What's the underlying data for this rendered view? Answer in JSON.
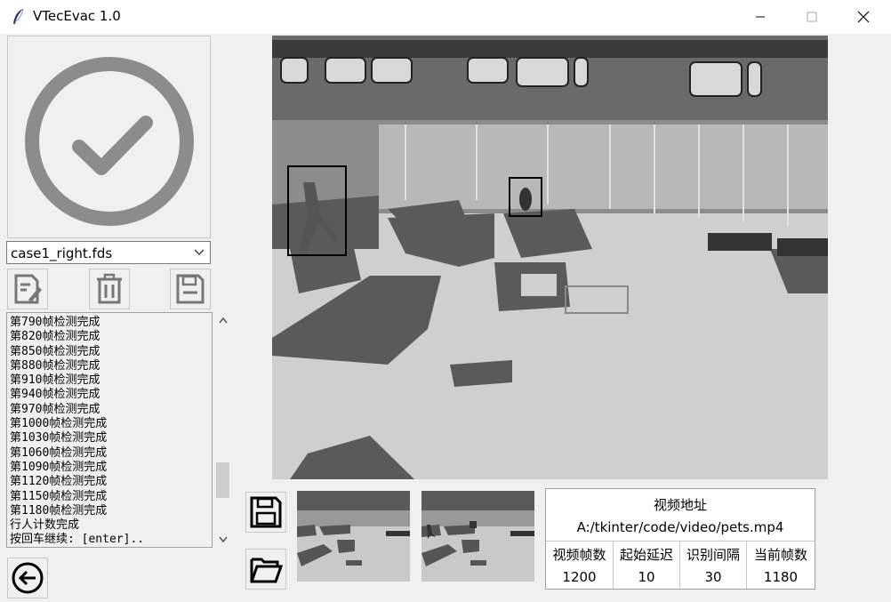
{
  "window": {
    "title": "VTecEvac 1.0"
  },
  "file_select": {
    "selected": "case1_right.fds"
  },
  "log": {
    "lines": [
      "第790帧检测完成",
      "第820帧检测完成",
      "第850帧检测完成",
      "第880帧检测完成",
      "第910帧检测完成",
      "第940帧检测完成",
      "第970帧检测完成",
      "第1000帧检测完成",
      "第1030帧检测完成",
      "第1060帧检测完成",
      "第1090帧检测完成",
      "第1120帧检测完成",
      "第1150帧检测完成",
      "第1180帧检测完成",
      "行人计数完成",
      "按回车继续: [enter].."
    ],
    "scroll_position": 0.8
  },
  "info": {
    "address_label": "视频地址",
    "address_value": "A:/tkinter/code/video/pets.mp4",
    "headers": [
      "视频帧数",
      "起始延迟",
      "识别间隔",
      "当前帧数"
    ],
    "values": [
      "1200",
      "10",
      "30",
      "1180"
    ]
  },
  "icons": {
    "status": "check-circle-icon",
    "edit": "edit-file-icon",
    "delete": "trash-icon",
    "save": "save-icon",
    "folder": "folder-open-icon",
    "back": "back-arrow-icon"
  }
}
